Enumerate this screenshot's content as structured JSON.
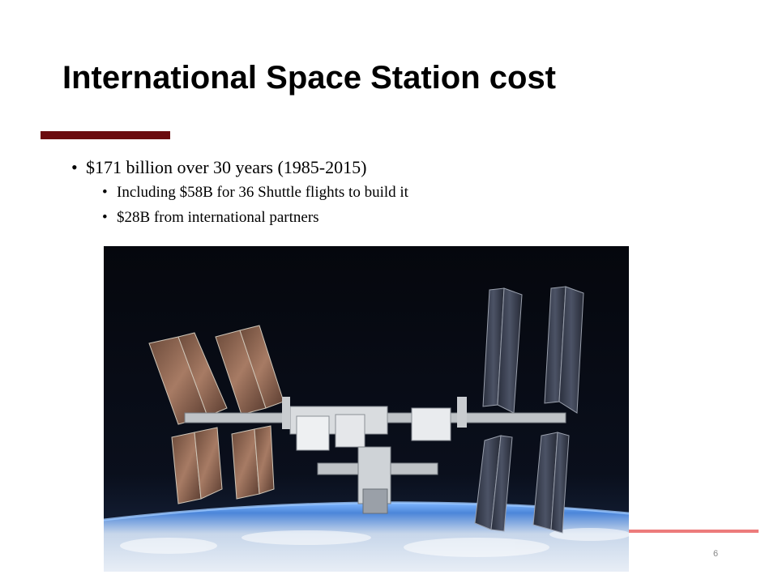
{
  "slide": {
    "title": "International Space Station cost",
    "bullets": [
      {
        "text": "$171 billion over 30 years (1985-2015)",
        "sub": [
          "Including $58B for 36 Shuttle flights to build it",
          "$28B from international partners"
        ]
      }
    ],
    "page_number": "6",
    "colors": {
      "accent_bar": "#6b0b0e",
      "bottom_line": "#ec7b7b"
    },
    "image": {
      "subject": "International Space Station photographed above Earth"
    }
  }
}
